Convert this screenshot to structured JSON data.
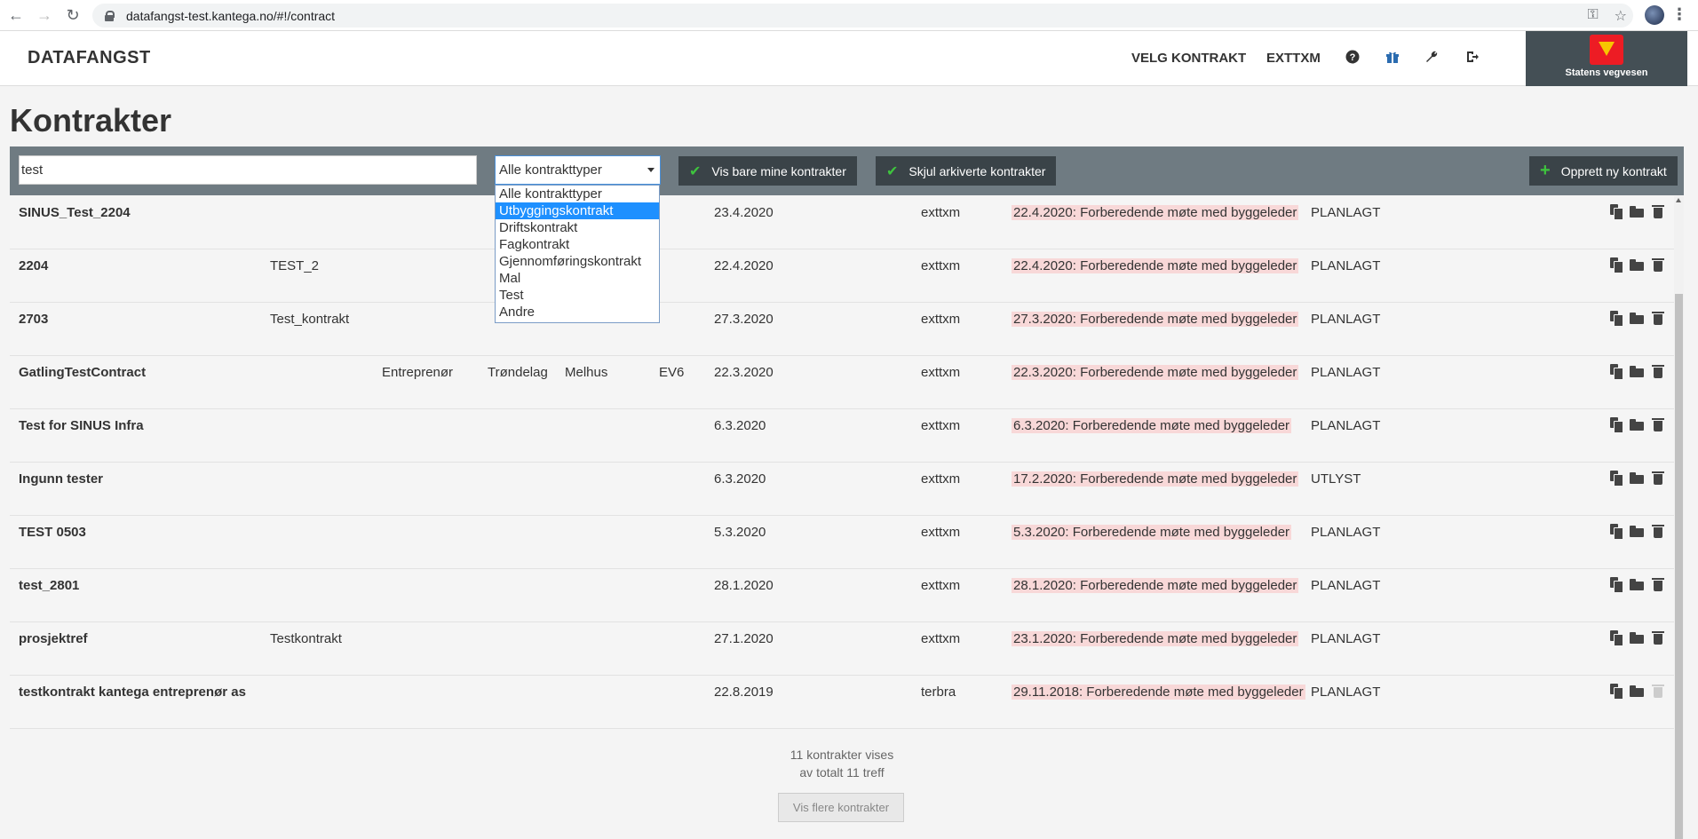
{
  "browser": {
    "url": "datafangst-test.kantega.no/#!/contract"
  },
  "header": {
    "brand": "DATAFANGST",
    "nav_contract": "VELG KONTRAKT",
    "nav_user": "EXTTXM",
    "logo_text": "Statens vegvesen"
  },
  "page": {
    "title": "Kontrakter"
  },
  "filters": {
    "search_value": "test",
    "type_selected": "Alle kontrakttyper",
    "type_options": [
      "Alle kontrakttyper",
      "Utbyggingskontrakt",
      "Driftskontrakt",
      "Fagkontrakt",
      "Gjennomføringskontrakt",
      "Mal",
      "Test",
      "Andre"
    ],
    "highlighted_option": "Utbyggingskontrakt",
    "only_mine_label": "Vis bare mine kontrakter",
    "hide_archived_label": "Skjul arkiverte kontrakter",
    "new_contract_label": "Opprett ny kontrakt"
  },
  "contracts": [
    {
      "name": "SINUS_Test_2204",
      "desc": "",
      "role": "",
      "county": "",
      "municipality": "",
      "road": "",
      "date": "23.4.2020",
      "user": "exttxm",
      "event": "22.4.2020: Forberedende møte med byggeleder",
      "status": "PLANLAGT"
    },
    {
      "name": "2204",
      "desc": "TEST_2",
      "role": "",
      "county": "",
      "municipality": "",
      "road": "",
      "date": "22.4.2020",
      "user": "exttxm",
      "event": "22.4.2020: Forberedende møte med byggeleder",
      "status": "PLANLAGT"
    },
    {
      "name": "2703",
      "desc": "Test_kontrakt",
      "role": "",
      "county": "",
      "municipality": "",
      "road": "",
      "date": "27.3.2020",
      "user": "exttxm",
      "event": "27.3.2020: Forberedende møte med byggeleder",
      "status": "PLANLAGT"
    },
    {
      "name": "GatlingTestContract",
      "desc": "",
      "role": "Entreprenør",
      "county": "Trøndelag",
      "municipality": "Melhus",
      "road": "EV6",
      "date": "22.3.2020",
      "user": "exttxm",
      "event": "22.3.2020: Forberedende møte med byggeleder",
      "status": "PLANLAGT"
    },
    {
      "name": "Test for SINUS Infra",
      "desc": "",
      "role": "",
      "county": "",
      "municipality": "",
      "road": "",
      "date": "6.3.2020",
      "user": "exttxm",
      "event": "6.3.2020: Forberedende møte med byggeleder",
      "status": "PLANLAGT"
    },
    {
      "name": "Ingunn tester",
      "desc": "",
      "role": "",
      "county": "",
      "municipality": "",
      "road": "",
      "date": "6.3.2020",
      "user": "exttxm",
      "event": "17.2.2020: Forberedende møte med byggeleder",
      "status": "UTLYST"
    },
    {
      "name": "TEST 0503",
      "desc": "",
      "role": "",
      "county": "",
      "municipality": "",
      "road": "",
      "date": "5.3.2020",
      "user": "exttxm",
      "event": "5.3.2020: Forberedende møte med byggeleder",
      "status": "PLANLAGT"
    },
    {
      "name": "test_2801",
      "desc": "",
      "role": "",
      "county": "",
      "municipality": "",
      "road": "",
      "date": "28.1.2020",
      "user": "exttxm",
      "event": "28.1.2020: Forberedende møte med byggeleder",
      "status": "PLANLAGT"
    },
    {
      "name": "prosjektref",
      "desc": "Testkontrakt",
      "role": "",
      "county": "",
      "municipality": "",
      "road": "",
      "date": "27.1.2020",
      "user": "exttxm",
      "event": "23.1.2020: Forberedende møte med byggeleder",
      "status": "PLANLAGT"
    },
    {
      "name": "testkontrakt kantega entreprenør as",
      "desc": "",
      "role": "",
      "county": "",
      "municipality": "",
      "road": "",
      "date": "22.8.2019",
      "user": "terbra",
      "event": "29.11.2018: Forberedende møte med byggeleder",
      "status": "PLANLAGT",
      "delete_disabled": true
    }
  ],
  "footer": {
    "shown": "11 kontrakter vises",
    "total": "av totalt 11 treff",
    "more_label": "Vis flere kontrakter"
  },
  "colors": {
    "filter_bar": "#6f7b82",
    "button_dark": "#3a4348",
    "check_green": "#3ec43e",
    "event_highlight": "#f8d8d8",
    "selected_option": "#1e90ff"
  }
}
